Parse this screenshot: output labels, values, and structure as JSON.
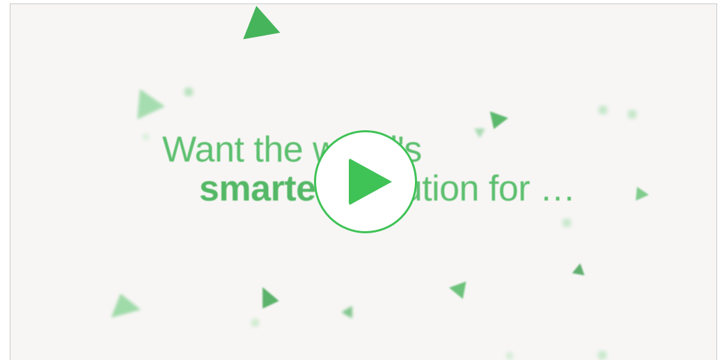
{
  "video": {
    "headline_line1": "Want the world's",
    "headline_line2_bold": "smartest",
    "headline_line2_rest": " solution for …",
    "accent_color": "#3fc256",
    "background_color": "#f8f6f5"
  },
  "controls": {
    "play_icon": "play-icon"
  }
}
